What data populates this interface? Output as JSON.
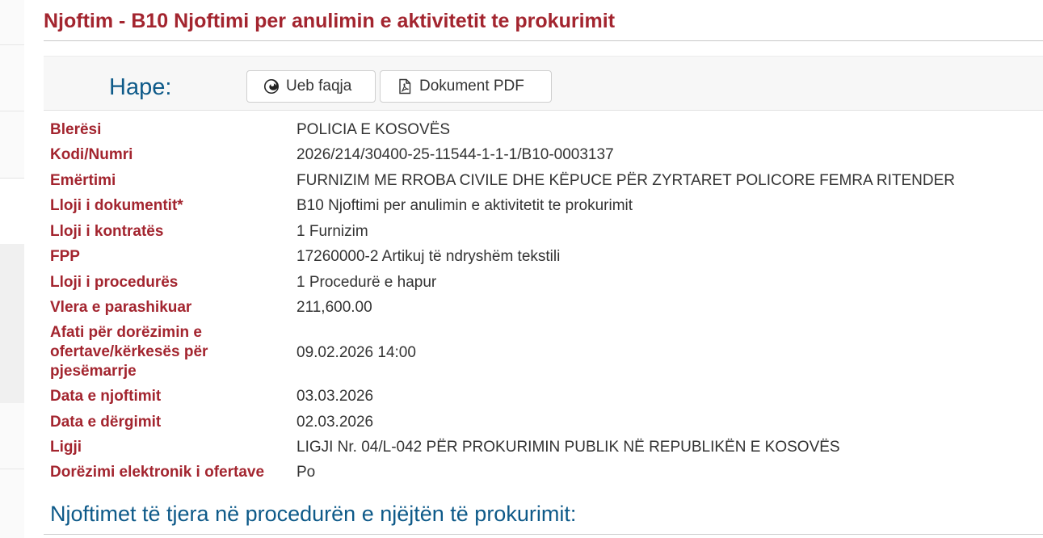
{
  "page": {
    "title": "Njoftim - B10 Njoftimi per anulimin e aktivitetit te prokurimit"
  },
  "open_bar": {
    "label": "Hape:",
    "web_button": "Ueb faqja",
    "pdf_button": "Dokument PDF",
    "web_icon": "firefox-icon",
    "pdf_icon": "pdf-file-icon"
  },
  "details": [
    {
      "key": "Blerësi",
      "value": "POLICIA E KOSOVËS"
    },
    {
      "key": "Kodi/Numri",
      "value": "2026/214/30400-25-11544-1-1-1/B10-0003137"
    },
    {
      "key": "Emërtimi",
      "value": "FURNIZIM ME RROBA CIVILE DHE KËPUCE PËR ZYRTARET POLICORE FEMRA RITENDER"
    },
    {
      "key": "Lloji i dokumentit*",
      "value": "B10 Njoftimi per anulimin e aktivitetit te prokurimit"
    },
    {
      "key": "Lloji i kontratës",
      "value": "1 Furnizim"
    },
    {
      "key": "FPP",
      "value": "17260000-2 Artikuj të ndryshëm tekstili"
    },
    {
      "key": "Lloji i procedurës",
      "value": "1 Procedurë e hapur"
    },
    {
      "key": "Vlera e parashikuar",
      "value": "211,600.00"
    },
    {
      "key": "Afati për dorëzimin e ofertave/kërkesës për pjesëmarrje",
      "value": "09.02.2026 14:00"
    },
    {
      "key": "Data e njoftimit",
      "value": "03.03.2026"
    },
    {
      "key": "Data e dërgimit",
      "value": "02.03.2026"
    },
    {
      "key": "Ligji",
      "value": "LIGJI Nr. 04/L-042 PËR PROKURIMIN PUBLIK NË REPUBLIKËN E KOSOVËS"
    },
    {
      "key": "Dorëzimi elektronik i ofertave",
      "value": "Po"
    }
  ],
  "related": {
    "title": "Njoftimet të tjera në procedurën e njëjtën të prokurimit:"
  },
  "colors": {
    "accent_red": "#a3252f",
    "accent_blue": "#0e5a89"
  }
}
